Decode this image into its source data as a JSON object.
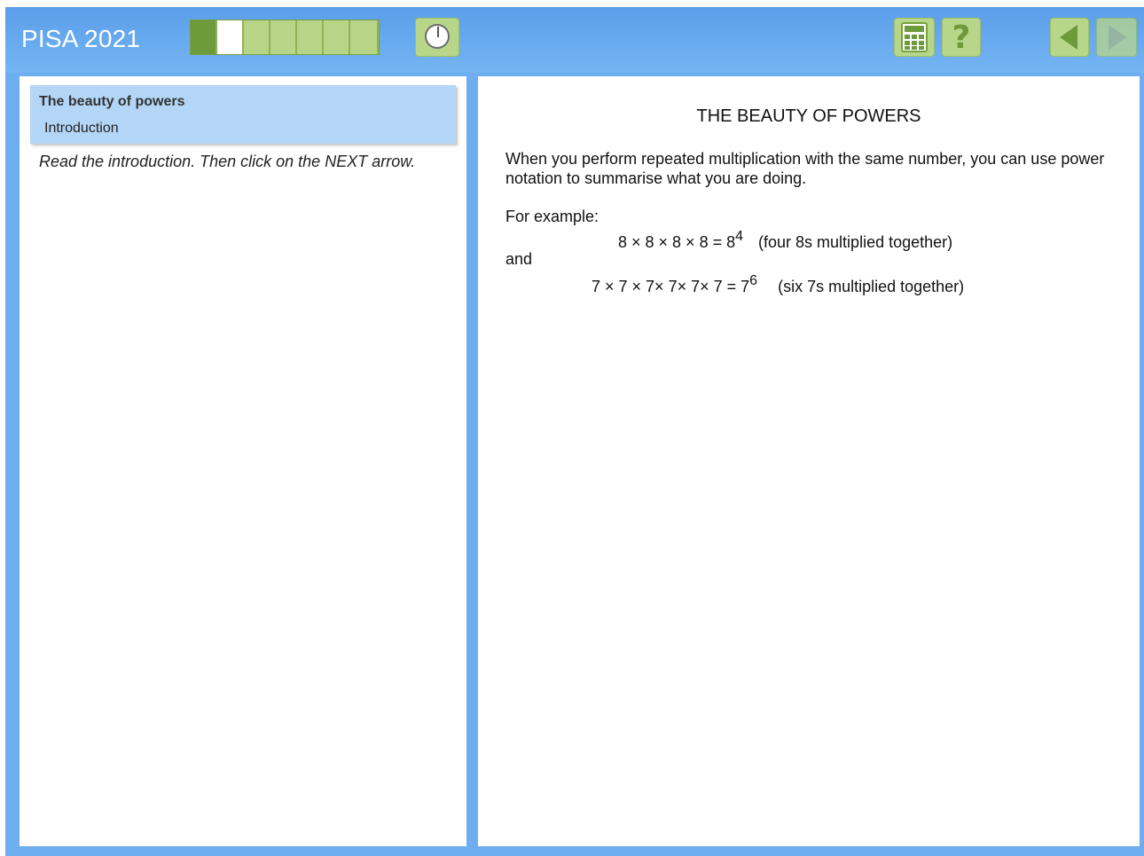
{
  "header": {
    "app_title": "PISA 2021",
    "progress_segments": [
      "done",
      "current",
      "todo",
      "todo",
      "todo",
      "todo",
      "todo"
    ],
    "icons": {
      "timer": "timer-icon",
      "calculator": "calculator-icon",
      "help": "help-icon",
      "help_glyph": "?",
      "back": "back-arrow-icon",
      "next": "next-arrow-icon"
    }
  },
  "left_panel": {
    "unit_title": "The beauty of powers",
    "unit_subtitle": "Introduction",
    "instruction": "Read the introduction. Then click on the NEXT arrow."
  },
  "stimulus": {
    "title": "THE BEAUTY OF POWERS",
    "paragraph": "When you perform repeated multiplication with the same number, you can use power notation to summarise what you are doing.",
    "example_label": "For example:",
    "example1_expr": "8 × 8 × 8 × 8 = 8",
    "example1_exp": "4",
    "example1_note": "(four 8s multiplied together)",
    "connector": "and",
    "example2_expr": "7 × 7 × 7× 7× 7× 7 = 7",
    "example2_exp": "6",
    "example2_note": "(six 7s multiplied together)"
  },
  "colors": {
    "frame_blue": "#6eaef0",
    "header_blue": "#5c9ee8",
    "button_green": "#b8d68a",
    "progress_done": "#6d9a3a",
    "unit_box_blue": "#b4d6f6"
  }
}
